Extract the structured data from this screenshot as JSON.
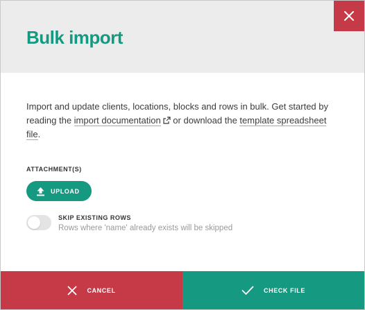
{
  "dialog": {
    "title": "Bulk import",
    "close_icon": "close-icon"
  },
  "intro": {
    "text_before": "Import and update clients, locations, blocks and rows in bulk. Get started by reading the ",
    "doc_link": "import documentation",
    "text_middle": " or download the ",
    "template_link": "template spreadsheet file",
    "text_after": "."
  },
  "attachments": {
    "label": "ATTACHMENT(S)",
    "upload_label": "UPLOAD",
    "upload_icon": "upload-icon"
  },
  "skip_toggle": {
    "title": "SKIP EXISTING ROWS",
    "hint": "Rows where 'name' already exists will be skipped",
    "checked": false
  },
  "footer": {
    "cancel_label": "CANCEL",
    "check_label": "CHECK FILE"
  },
  "colors": {
    "accent": "#159980",
    "danger": "#c63a48",
    "header_bg": "#ececec"
  }
}
